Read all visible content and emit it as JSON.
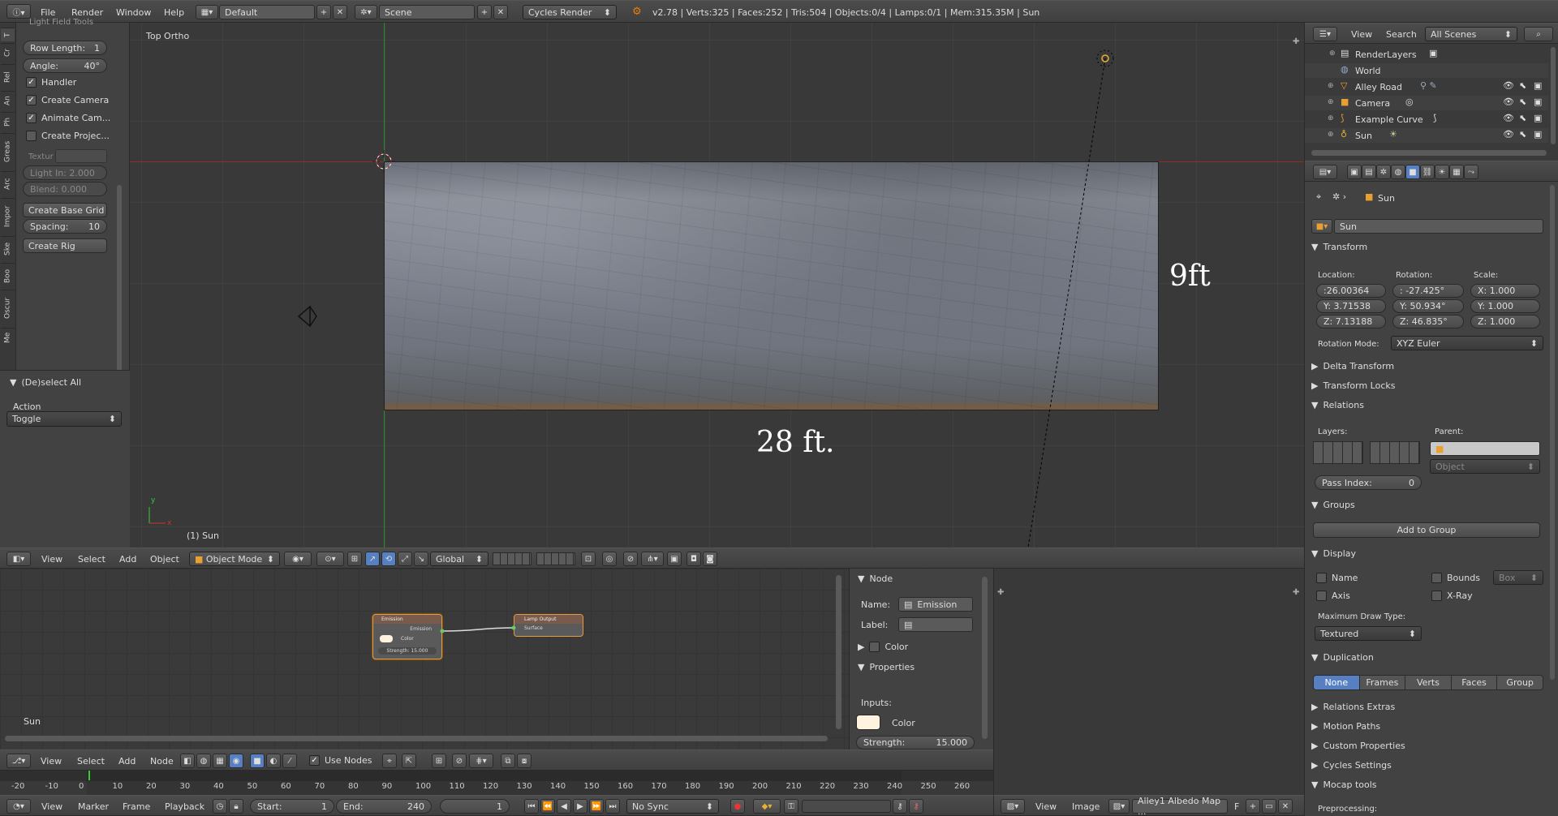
{
  "topbar": {
    "menus": [
      "File",
      "Render",
      "Window",
      "Help"
    ],
    "layout": "Default",
    "scene": "Scene",
    "engine": "Cycles Render",
    "stats": "v2.78 | Verts:325 | Faces:252 | Tris:504 | Objects:0/4 | Lamps:0/1 | Mem:315.35M | Sun"
  },
  "toolshelf": {
    "tabs": [
      "T",
      "Cr",
      "Rel",
      "An",
      "Ph",
      "Greas",
      "Arc",
      "Impor",
      "Ske",
      "Boo",
      "Oscur",
      "Me"
    ],
    "section": "Light Field Tools",
    "row_length_label": "Row Length:",
    "row_length": "1",
    "angle_label": "Angle:",
    "angle": "40°",
    "handler": "Handler",
    "create_camera": "Create Camera",
    "animate_camera": "Animate Cam...",
    "create_projector": "Create Projec...",
    "texture": "Textur",
    "light_in": "Light In: 2.000",
    "blend": "Blend:   0.000",
    "create_base_grid": "Create Base Grid",
    "spacing_label": "Spacing:",
    "spacing": "10",
    "create_rig": "Create Rig",
    "op_title": "(De)select All",
    "action_label": "Action",
    "action_value": "Toggle"
  },
  "viewport": {
    "view_name": "Top Ortho",
    "object_label": "(1) Sun",
    "height_label": "9ft",
    "width_label": "28 ft.",
    "axis_y": "y",
    "axis_x": "x"
  },
  "viewport_header": {
    "menus": [
      "View",
      "Select",
      "Add",
      "Object"
    ],
    "mode": "Object Mode",
    "orientation": "Global"
  },
  "node_editor": {
    "emission_title": "Emission",
    "emission_out": "Emission",
    "color_label": "Color",
    "strength_chip": "Strength: 15.000",
    "output_title": "Lamp Output",
    "surface_label": "Surface",
    "object_label": "Sun"
  },
  "node_panel": {
    "node_title": "Node",
    "name_label": "Name:",
    "name_value": "Emission",
    "label_label": "Label:",
    "label_value": "",
    "color_section": "Color",
    "properties": "Properties",
    "inputs": "Inputs:",
    "color_label": "Color",
    "strength_label": "Strength:",
    "strength_value": "15.000"
  },
  "node_header": {
    "menus": [
      "View",
      "Select",
      "Add",
      "Node"
    ],
    "use_nodes": "Use Nodes"
  },
  "timeline": {
    "ticks": [
      "-20",
      "-10",
      "0",
      "10",
      "20",
      "30",
      "40",
      "50",
      "60",
      "70",
      "80",
      "90",
      "100",
      "110",
      "120",
      "130",
      "140",
      "150",
      "160",
      "170",
      "180",
      "190",
      "200",
      "210",
      "220",
      "230",
      "240",
      "250",
      "260"
    ],
    "menus": [
      "View",
      "Marker",
      "Frame",
      "Playback"
    ],
    "start_label": "Start:",
    "start": "1",
    "end_label": "End:",
    "end": "240",
    "current": "1",
    "sync": "No Sync"
  },
  "image_header": {
    "menus": [
      "View",
      "Image"
    ],
    "image_name": "Alley1 Albedo Map ...",
    "fake_user": "F"
  },
  "outliner": {
    "menus": [
      "View",
      "Search"
    ],
    "scope": "All Scenes",
    "items": [
      "RenderLayers",
      "World",
      "Alley Road",
      "Camera",
      "Example Curve",
      "Sun"
    ]
  },
  "properties": {
    "object_name": "Sun",
    "data_name": "Sun",
    "transform": "Transform",
    "location_label": "Location:",
    "rotation_label": "Rotation:",
    "scale_label": "Scale:",
    "location": [
      ":26.00364",
      "Y: 3.71538",
      "Z: 7.13188"
    ],
    "rotation": [
      ": -27.425°",
      "Y: 50.934°",
      "Z: 46.835°"
    ],
    "scale": [
      "X:   1.000",
      "Y:   1.000",
      "Z:   1.000"
    ],
    "rotation_mode_label": "Rotation Mode:",
    "rotation_mode": "XYZ Euler",
    "delta_transform": "Delta Transform",
    "transform_locks": "Transform Locks",
    "relations": "Relations",
    "layers_label": "Layers:",
    "parent_label": "Parent:",
    "parent_type": "Object",
    "pass_index": "Pass Index:",
    "pass_index_value": "0",
    "groups": "Groups",
    "add_to_group": "Add to Group",
    "display": "Display",
    "name_opt": "Name",
    "bounds_opt": "Bounds",
    "bounds_type": "Box",
    "axis_opt": "Axis",
    "xray_opt": "X-Ray",
    "max_draw_label": "Maximum Draw Type:",
    "max_draw": "Textured",
    "duplication": "Duplication",
    "dup_tabs": [
      "None",
      "Frames",
      "Verts",
      "Faces",
      "Group"
    ],
    "relations_extras": "Relations Extras",
    "motion_paths": "Motion Paths",
    "custom_properties": "Custom Properties",
    "cycles_settings": "Cycles Settings",
    "mocap_tools": "Mocap tools",
    "preprocessing": "Preprocessing:"
  }
}
